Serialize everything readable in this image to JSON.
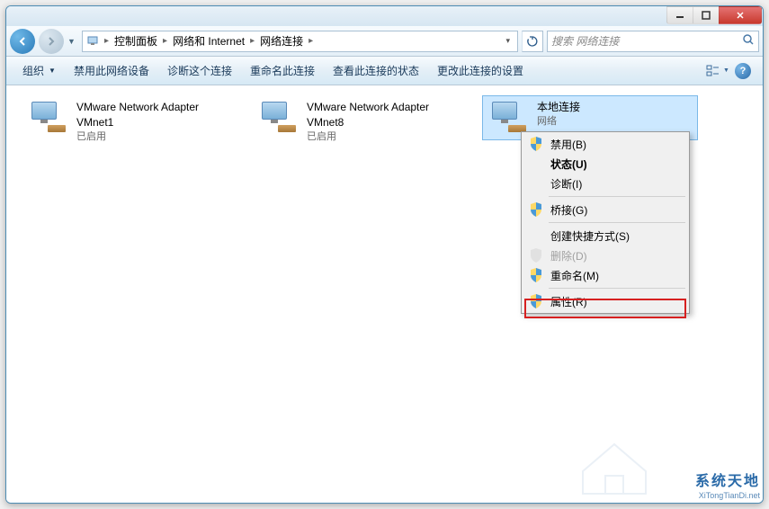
{
  "breadcrumb": {
    "items": [
      "控制面板",
      "网络和 Internet",
      "网络连接"
    ]
  },
  "search": {
    "placeholder": "搜索 网络连接"
  },
  "toolbar": {
    "organize": "组织",
    "disable": "禁用此网络设备",
    "diagnose": "诊断这个连接",
    "rename": "重命名此连接",
    "status": "查看此连接的状态",
    "settings": "更改此连接的设置"
  },
  "adapters": [
    {
      "title": "VMware Network Adapter",
      "subtitle": "VMnet1",
      "status": "已启用"
    },
    {
      "title": "VMware Network Adapter",
      "subtitle": "VMnet8",
      "status": "已启用"
    },
    {
      "title": "本地连接",
      "subtitle": "网络",
      "status": ""
    }
  ],
  "context_menu": {
    "disable": "禁用(B)",
    "status": "状态(U)",
    "diagnose": "诊断(I)",
    "bridge": "桥接(G)",
    "shortcut": "创建快捷方式(S)",
    "delete": "删除(D)",
    "rename": "重命名(M)",
    "properties": "属性(R)"
  },
  "watermark": {
    "title": "系统天地",
    "url": "XiTongTianDi.net"
  }
}
